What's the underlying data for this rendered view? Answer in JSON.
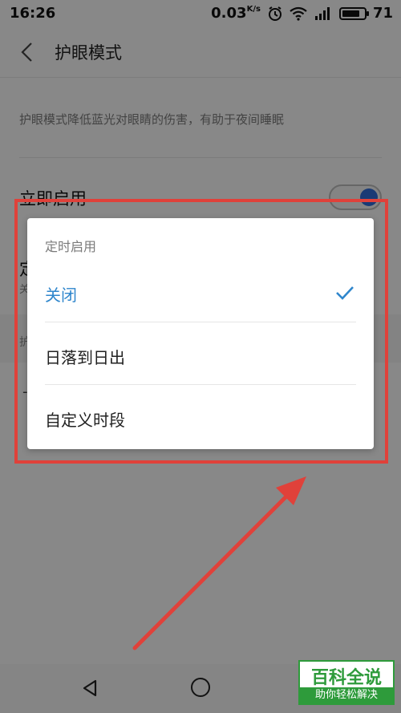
{
  "statusbar": {
    "time": "16:26",
    "speed": "0.03",
    "speed_unit": "K/s",
    "battery": "71"
  },
  "header": {
    "title": "护眼模式"
  },
  "page": {
    "description": "护眼模式降低蓝光对眼睛的伤害，有助于夜间睡眠",
    "enable_label": "立即启用",
    "schedule_label_partial": "定",
    "schedule_sub_partial": "关",
    "section_label_partial": "护",
    "dash": "-"
  },
  "dialog": {
    "title": "定时启用",
    "options": [
      {
        "label": "关闭",
        "selected": true
      },
      {
        "label": "日落到日出",
        "selected": false
      },
      {
        "label": "自定义时段",
        "selected": false
      }
    ]
  },
  "watermark": {
    "top": "百科全说",
    "bottom": "助你轻松解决"
  },
  "colors": {
    "accent": "#2f86cc",
    "annotation": "#e0413a",
    "watermark": "#2e9b3b"
  }
}
